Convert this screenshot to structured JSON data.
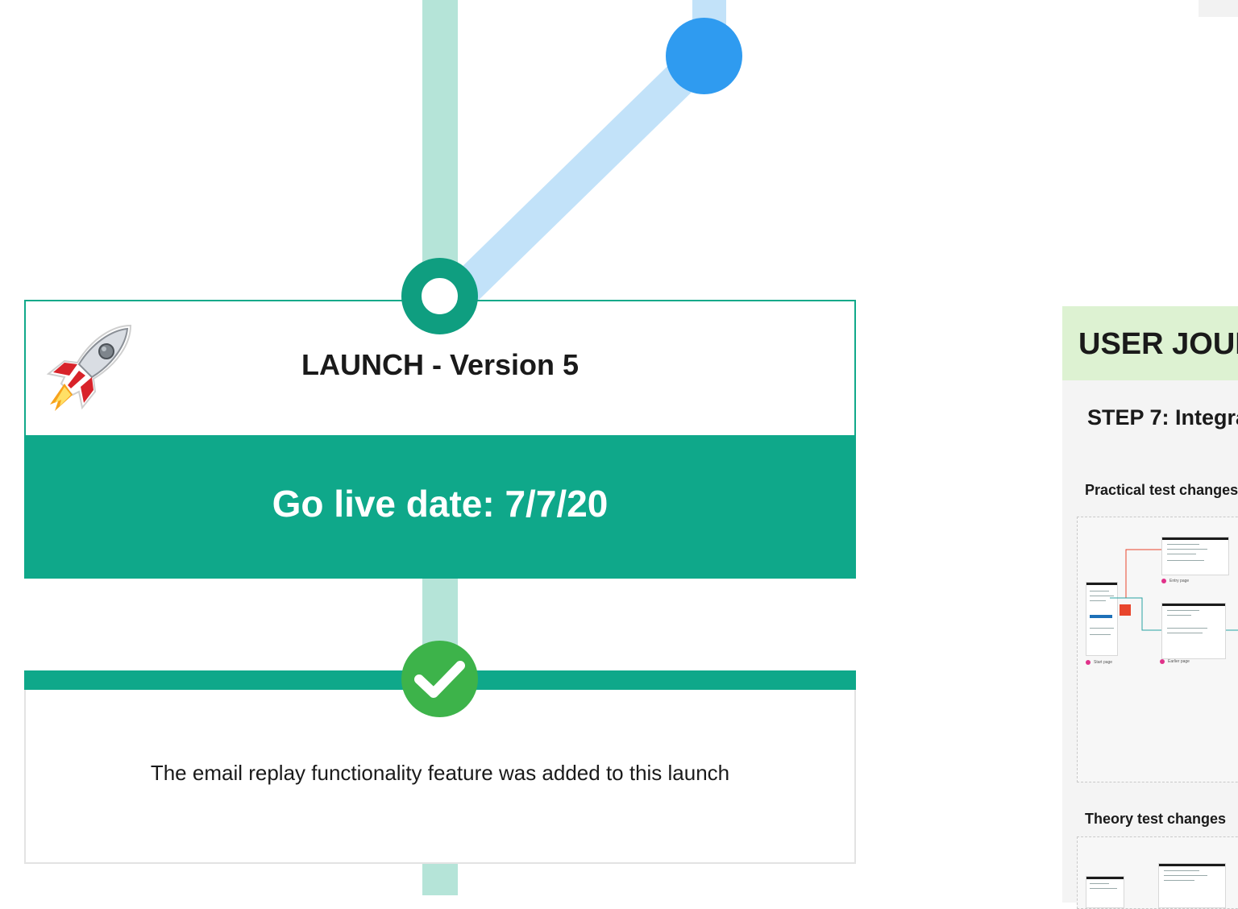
{
  "colors": {
    "teal": "#0fa88a",
    "teal_light": "#b5e4d8",
    "blue": "#2f9bf0",
    "blue_light": "#c2e2f9",
    "check_green": "#3db34a",
    "journey_header": "#ddf2d2"
  },
  "launch": {
    "icon": "rocket-icon",
    "title": "LAUNCH - Version 5",
    "go_live": "Go live date: 7/7/20"
  },
  "feature": {
    "icon": "checkmark-icon",
    "text": "The email replay functionality feature was added to this launch"
  },
  "journey": {
    "title": "USER JOURNI",
    "step": "STEP 7: Integra",
    "sections": [
      {
        "label": "Practical test changes",
        "thumbnails": [
          "Start page",
          "Entry page",
          "Earlier page"
        ]
      },
      {
        "label": "Theory test changes"
      }
    ]
  }
}
